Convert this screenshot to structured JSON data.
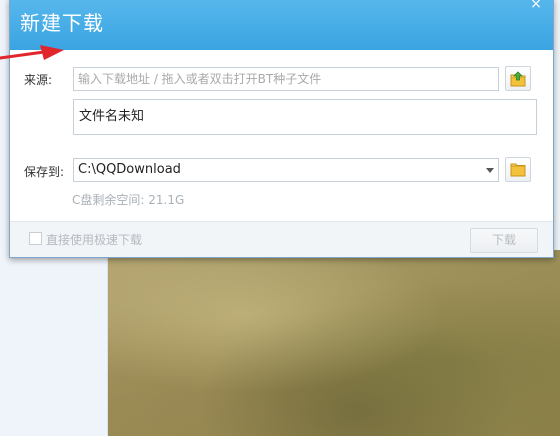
{
  "dialog": {
    "title": "新建下载",
    "close_glyph": "×",
    "source": {
      "label": "来源:",
      "placeholder": "输入下载地址 / 拖入或者双击打开BT种子文件",
      "browse_icon": "upload-folder-icon"
    },
    "file_name": "文件名未知",
    "save": {
      "label": "保存到:",
      "path": "C:\\QQDownload",
      "folder_icon": "folder-icon"
    },
    "disk_space": "C盘剩余空间: 21.1G",
    "footer": {
      "fast_download_label": "直接使用极速下载",
      "fast_download_checked": false,
      "download_button": "下载",
      "download_enabled": false
    }
  },
  "colors": {
    "titlebar": "#3aa4e2",
    "annotation_arrow": "#e0262b"
  }
}
